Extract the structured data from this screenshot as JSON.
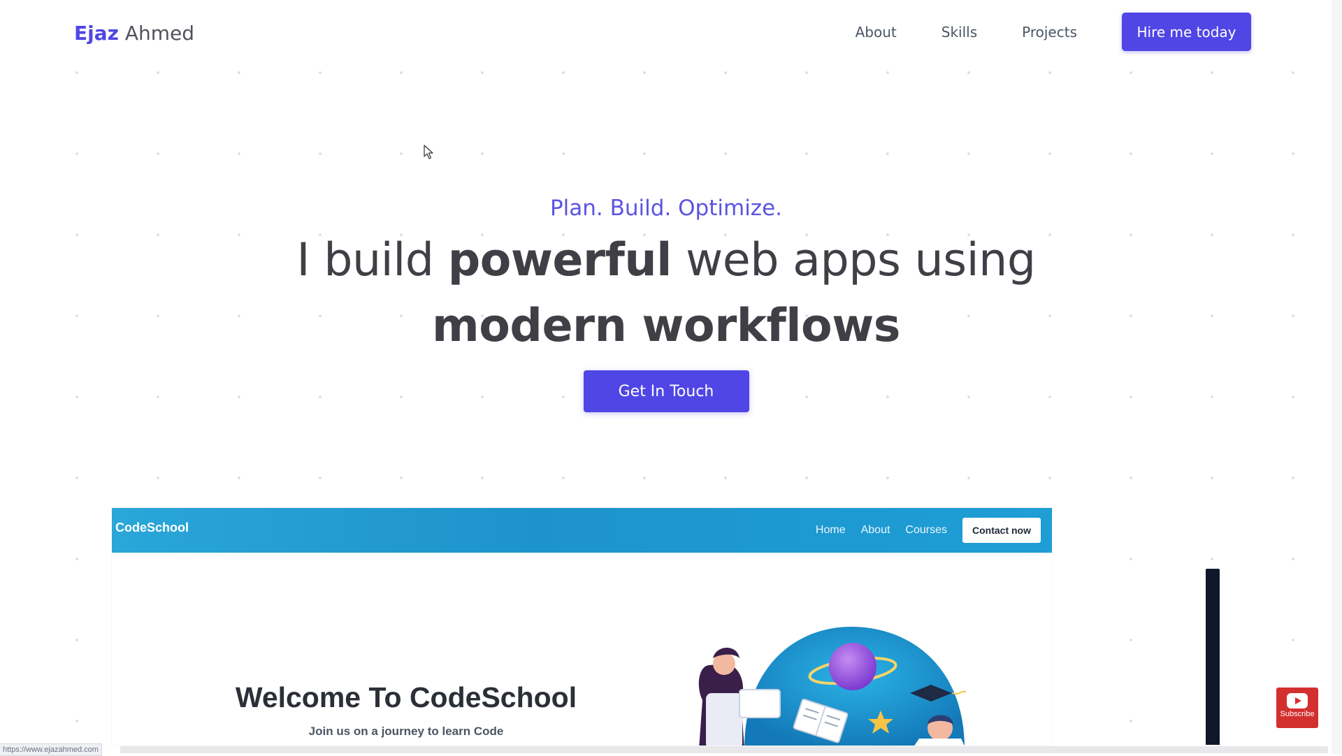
{
  "header": {
    "logo_first": "Ejaz",
    "logo_last": "Ahmed",
    "nav": [
      {
        "label": "About"
      },
      {
        "label": "Skills"
      },
      {
        "label": "Projects"
      }
    ],
    "hire_button": "Hire me today"
  },
  "hero": {
    "tagline": "Plan. Build. Optimize.",
    "headline_part1": "I build ",
    "headline_bold1": "powerful",
    "headline_part2": " web apps using",
    "headline_bold2": "modern workflows",
    "cta": "Get In Touch"
  },
  "preview": {
    "logo": "CodeSchool",
    "nav": [
      {
        "label": "Home"
      },
      {
        "label": "About"
      },
      {
        "label": "Courses"
      }
    ],
    "contact_button": "Contact now",
    "welcome_title": "Welcome To CodeSchool",
    "welcome_subtitle": "Join us on a journey to learn Code"
  },
  "subscribe": {
    "label": "Subscribe"
  },
  "status_bar": {
    "url": "https://www.ejazahmed.com"
  },
  "colors": {
    "accent": "#4f46e5",
    "codeschool_blue": "#1f9ed6",
    "subscribe_red": "#d32f2f"
  },
  "icons": {
    "cursor": "mouse-pointer-icon",
    "subscribe": "youtube-play-icon"
  }
}
